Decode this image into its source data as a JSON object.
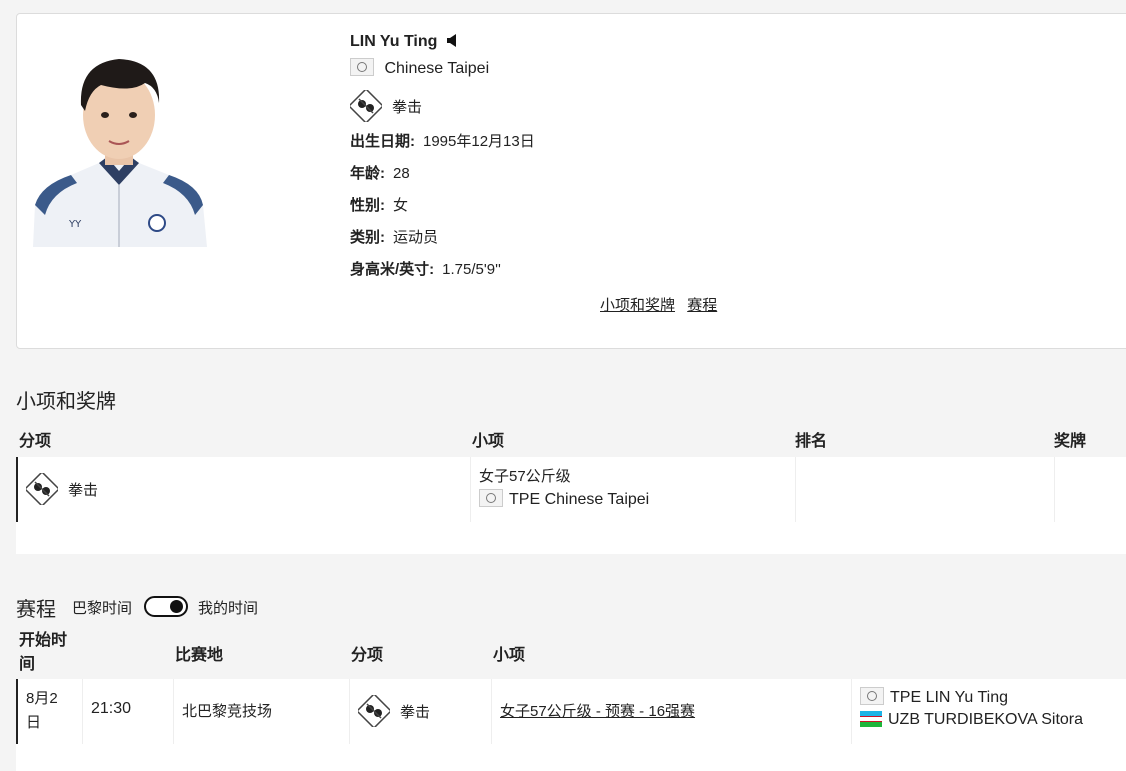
{
  "profile": {
    "name": "LIN Yu Ting",
    "country": "Chinese Taipei",
    "sport": "拳击",
    "fields": [
      {
        "label": "出生日期:",
        "value": "1995年12月13日"
      },
      {
        "label": "年龄:",
        "value": "28"
      },
      {
        "label": "性别:",
        "value": "女"
      },
      {
        "label": "类别:",
        "value": "运动员"
      },
      {
        "label": "身高米/英寸:",
        "value": "1.75/5'9''"
      }
    ],
    "links": [
      "小项和奖牌",
      "赛程"
    ]
  },
  "events": {
    "title": "小项和奖牌",
    "columns": [
      "分项",
      "小项",
      "排名",
      "奖牌"
    ],
    "row": {
      "discipline": "拳击",
      "event": "女子57公斤级",
      "team": "TPE Chinese Taipei",
      "rank": "",
      "medal": ""
    }
  },
  "schedule": {
    "title": "赛程",
    "toggle_left": "巴黎时间",
    "toggle_right": "我的时间",
    "columns": [
      "开始时间",
      "比赛地",
      "分项",
      "小项"
    ],
    "row": {
      "date": "8月2日",
      "time": "21:30",
      "venue": "北巴黎竞技场",
      "discipline": "拳击",
      "event": "女子57公斤级 - 预赛 - 16强赛",
      "competitors": [
        "TPE LIN Yu Ting",
        "UZB TURDIBEKOVA Sitora"
      ]
    }
  },
  "colors": {
    "accent": "#222222",
    "background": "#f4f4f4",
    "card": "#ffffff"
  },
  "icons": [
    "speaker-icon",
    "boxing-icon",
    "flag-icon",
    "toggle"
  ]
}
